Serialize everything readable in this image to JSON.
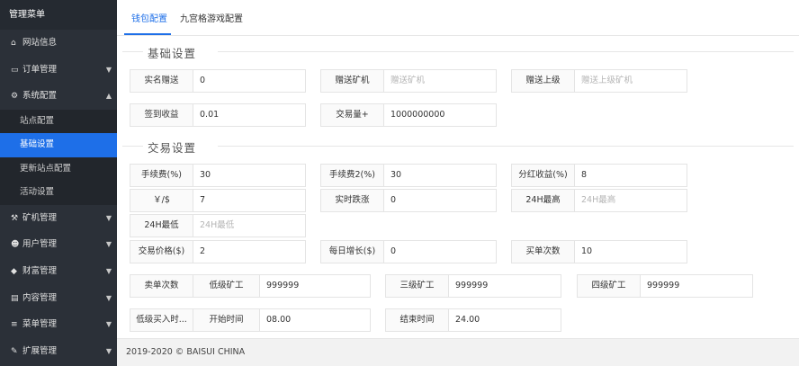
{
  "sidebar": {
    "title": "管理菜单",
    "items": [
      {
        "icon": "home-icon",
        "glyph": "⌂",
        "label": "网站信息",
        "arrow": ""
      },
      {
        "icon": "credit-card-icon",
        "glyph": "▭",
        "label": "订单管理",
        "arrow": "▼"
      },
      {
        "icon": "gears-icon",
        "glyph": "⚙",
        "label": "系统配置",
        "arrow": "▲"
      },
      {
        "icon": "pickaxe-icon",
        "glyph": "⚒",
        "label": "矿机管理",
        "arrow": "▼"
      },
      {
        "icon": "users-icon",
        "glyph": "☻",
        "label": "用户管理",
        "arrow": "▼"
      },
      {
        "icon": "diamond-icon",
        "glyph": "◆",
        "label": "财富管理",
        "arrow": "▼"
      },
      {
        "icon": "file-icon",
        "glyph": "▤",
        "label": "内容管理",
        "arrow": "▼"
      },
      {
        "icon": "list-icon",
        "glyph": "≡",
        "label": "菜单管理",
        "arrow": "▼"
      },
      {
        "icon": "wrench-icon",
        "glyph": "✎",
        "label": "扩展管理",
        "arrow": "▼"
      }
    ],
    "sub": [
      "站点配置",
      "基础设置",
      "更新站点配置",
      "活动设置"
    ]
  },
  "tabs": [
    "钱包配置",
    "九宫格游戏配置"
  ],
  "sections": {
    "basic": "基础设置",
    "trade": "交易设置"
  },
  "basic": {
    "r1": [
      {
        "label": "实名赠送",
        "value": "0",
        "placeholder": ""
      },
      {
        "label": "赠送矿机",
        "value": "",
        "placeholder": "赠送矿机"
      },
      {
        "label": "赠送上级",
        "value": "",
        "placeholder": "赠送上级矿机"
      }
    ],
    "r2": [
      {
        "label": "签到收益",
        "value": "0.01"
      },
      {
        "label": "交易量+",
        "value": "1000000000"
      }
    ]
  },
  "trade": {
    "r1": [
      {
        "label": "手续费(%)",
        "value": "30"
      },
      {
        "label": "手续费2(%)",
        "value": "30"
      },
      {
        "label": "分红收益(%)",
        "value": "8"
      }
    ],
    "r2": [
      {
        "label": "￥/$",
        "value": "7",
        "placeholder": ""
      },
      {
        "label": "实时跌涨",
        "value": "0",
        "placeholder": ""
      },
      {
        "label": "24H最高",
        "value": "",
        "placeholder": "24H最高"
      }
    ],
    "r3": {
      "label": "24H最低",
      "value": "",
      "placeholder": "24H最低"
    },
    "r4": [
      {
        "label": "交易价格($)",
        "value": "2"
      },
      {
        "label": "每日增长($)",
        "value": "0"
      },
      {
        "label": "买单次数",
        "value": "10"
      }
    ],
    "r5": {
      "sell_label": "卖单次数",
      "miners": [
        {
          "label": "低级矿工",
          "value": "999999"
        },
        {
          "label": "三级矿工",
          "value": "999999"
        },
        {
          "label": "四级矿工",
          "value": "999999"
        }
      ]
    },
    "r6": {
      "low_buy_label": "低级买入时...",
      "start_label": "开始时间",
      "start_value": "08.00",
      "end_label": "结束时间",
      "end_value": "24.00"
    }
  },
  "footer": "2019-2020 © BAISUI CHINA"
}
